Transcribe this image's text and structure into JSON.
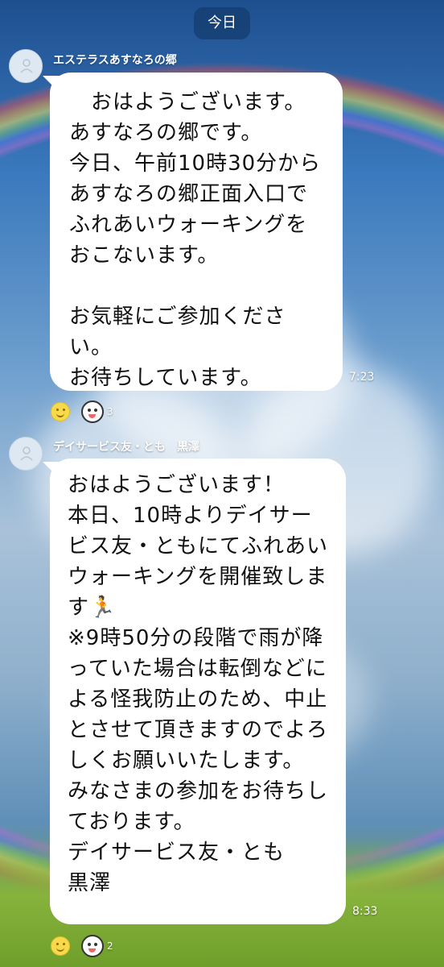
{
  "date_chip": "今日",
  "messages": [
    {
      "sender": "エステラスあすなろの郷",
      "text": "　おはようございます。\nあすなろの郷です。\n今日、午前10時30分から\nあすなろの郷正面入口でふれあいウォーキングをおこないます。\n\nお気軽にご参加ください。\nお待ちしています。",
      "time": "7:23",
      "reaction_count": "3"
    },
    {
      "sender": "デイサービス友・とも　黒澤",
      "text": "おはようございます！\n本日、10時よりデイサービス友・ともにてふれあいウォーキングを開催致します🏃\n※9時50分の段階で雨が降っていた場合は転倒などによる怪我防止のため、中止とさせて頂きますのでよろしくお願いいたします。\nみなさまの参加をお待ちしております。\nデイサービス友・とも\n黒澤",
      "time": "8:33",
      "reaction_count": "2"
    }
  ]
}
